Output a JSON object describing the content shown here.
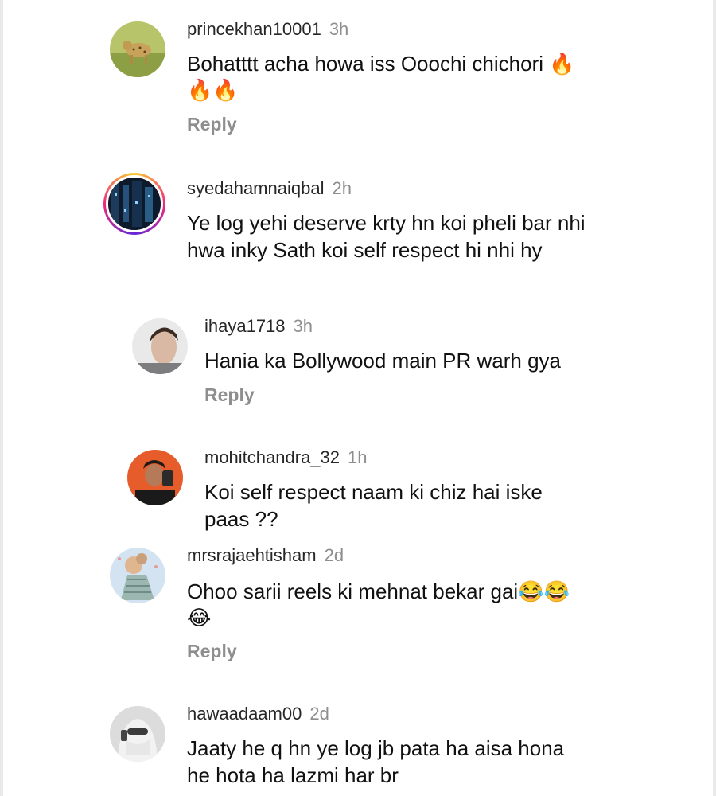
{
  "comments": [
    {
      "username": "princekhan10001",
      "time": "3h",
      "text_line1": "Bohatttt acha howa iss Ooochi chichori 🔥",
      "text_line2": "🔥🔥",
      "reply": "Reply"
    },
    {
      "username": "syedahamnaiqbal",
      "time": "2h",
      "text_line1": "Ye log yehi deserve krty hn koi pheli bar nhi",
      "text_line2": "hwa inky Sath koi self respect hi nhi hy"
    },
    {
      "username": "ihaya1718",
      "time": "3h",
      "text_line1": "Hania ka Bollywood main PR warh gya",
      "reply": "Reply"
    },
    {
      "username": "mohitchandra_32",
      "time": "1h",
      "text_line1": "Koi self respect naam ki chiz hai iske",
      "text_line2": "paas ??"
    },
    {
      "username": "mrsrajaehtisham",
      "time": "2d",
      "text_line1": "Ohoo sarii reels ki mehnat bekar gai😂😂",
      "text_line2": "😂",
      "reply": "Reply"
    },
    {
      "username": "hawaadaam00",
      "time": "2d",
      "text_line1": "Jaaty he q hn ye log jb pata ha aisa hona",
      "text_line2": "he hota ha lazmi har br"
    }
  ]
}
